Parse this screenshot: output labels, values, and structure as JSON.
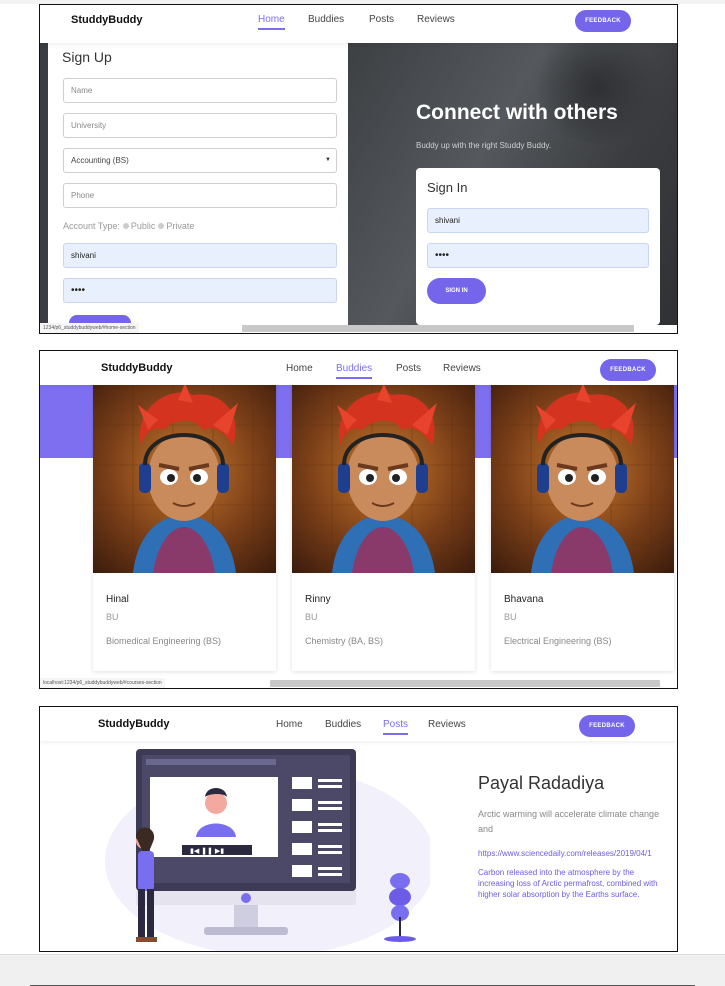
{
  "nav": {
    "brand": "StuddyBuddy",
    "home": "Home",
    "buddies": "Buddies",
    "posts": "Posts",
    "reviews": "Reviews",
    "feedback": "FEEDBACK"
  },
  "signup": {
    "title": "Sign Up",
    "name_placeholder": "Name",
    "university_placeholder": "University",
    "major_value": "Accounting (BS)",
    "phone_placeholder": "Phone",
    "account_type_label": "Account Type:",
    "public_label": "Public",
    "private_label": "Private",
    "username_value": "shivani",
    "password_value": "••••"
  },
  "hero": {
    "title": "Connect with others",
    "subtitle": "Buddy up with the right Studdy Buddy."
  },
  "signin": {
    "title": "Sign In",
    "username_value": "shivani",
    "password_value": "••••",
    "button": "SIGN IN"
  },
  "status": {
    "shot1_url": "1234/p6_studdybuddyweb/#home-section",
    "shot2_url": "localhost:1234/p6_studdybuddyweb/#courses-section"
  },
  "buddies": [
    {
      "name": "Hinal",
      "university": "BU",
      "major": "Biomedical Engineering (BS)"
    },
    {
      "name": "Rinny",
      "university": "BU",
      "major": "Chemistry (BA, BS)"
    },
    {
      "name": "Bhavana",
      "university": "BU",
      "major": "Electrical Engineering (BS)"
    }
  ],
  "post": {
    "author": "Payal Radadiya",
    "text": "Arctic warming will accelerate climate change and",
    "link": "https://www.sciencedaily.com/releases/2019/04/1",
    "quote": "Carbon released into the atmosphere by the increasing loss of Arctic permafrost, combined with higher solar absorption by the Earths surface."
  },
  "colors": {
    "accent": "#7465ea",
    "band": "#7d6ff0",
    "link": "#6c5ce7"
  }
}
